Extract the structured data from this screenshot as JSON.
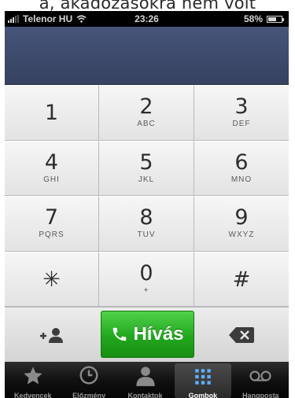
{
  "overlay_caption": "a, akadozásokra nem volt",
  "status_bar": {
    "carrier": "Telenor HU",
    "time": "23:26",
    "battery": "58%",
    "battery_level": 0.58
  },
  "keypad": [
    {
      "digit": "1",
      "letters": ""
    },
    {
      "digit": "2",
      "letters": "ABC"
    },
    {
      "digit": "3",
      "letters": "DEF"
    },
    {
      "digit": "4",
      "letters": "GHI"
    },
    {
      "digit": "5",
      "letters": "JKL"
    },
    {
      "digit": "6",
      "letters": "MNO"
    },
    {
      "digit": "7",
      "letters": "PQRS"
    },
    {
      "digit": "8",
      "letters": "TUV"
    },
    {
      "digit": "9",
      "letters": "WXYZ"
    },
    {
      "digit": "✳",
      "letters": ""
    },
    {
      "digit": "0",
      "letters": "+"
    },
    {
      "digit": "#",
      "letters": ""
    }
  ],
  "actions": {
    "add_contact_icon": "add-contact-icon",
    "call_label": "Hívás",
    "delete_icon": "backspace-icon",
    "call_color": "#2cb127"
  },
  "tabbar": {
    "active_index": 3,
    "tabs": [
      {
        "label": "Kedvencek",
        "icon": "star-icon"
      },
      {
        "label": "Előzmény",
        "icon": "clock-icon"
      },
      {
        "label": "Kontaktok",
        "icon": "person-icon"
      },
      {
        "label": "Gombok",
        "icon": "keypad-icon"
      },
      {
        "label": "Hangposta",
        "icon": "voicemail-icon"
      }
    ]
  }
}
